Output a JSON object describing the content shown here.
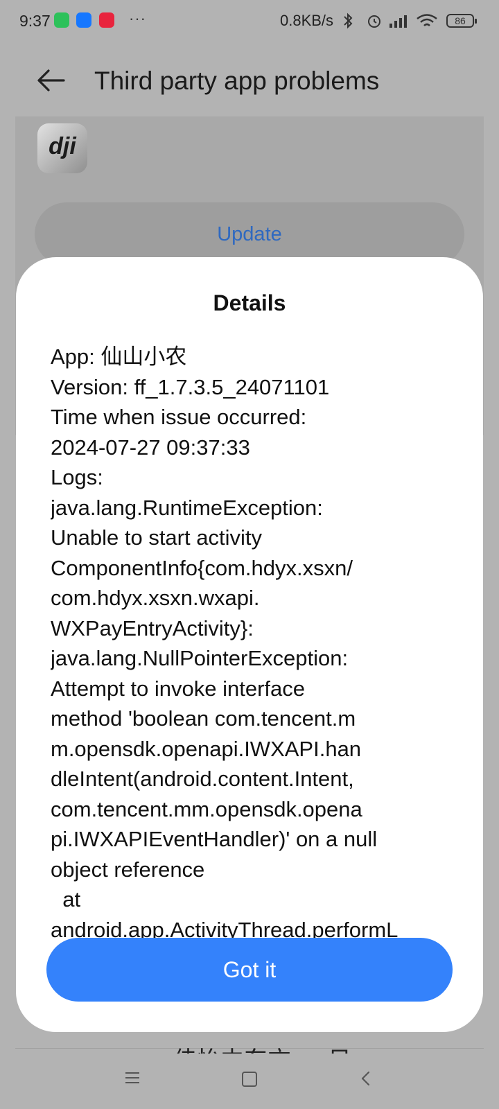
{
  "status_bar": {
    "time": "9:37",
    "dots": "···",
    "network_speed": "0.8KB/s",
    "battery": "86"
  },
  "header": {
    "title": "Third party app problems"
  },
  "background_card": {
    "app_logo_text": "dji",
    "update_label": "Update",
    "bottom_partial_text": "佳怡中东方 一 日 "
  },
  "dialog": {
    "title": "Details",
    "details": "App: 仙山小农\nVersion: ff_1.7.3.5_24071101\nTime when issue occurred:\n2024-07-27 09:37:33\nLogs:\njava.lang.RuntimeException:\nUnable to start activity\nComponentInfo{com.hdyx.xsxn/\ncom.hdyx.xsxn.wxapi.\nWXPayEntryActivity}:\njava.lang.NullPointerException:\nAttempt to invoke interface\nmethod 'boolean com.tencent.m\nm.opensdk.openapi.IWXAPI.han\ndleIntent(android.content.Intent,\ncom.tencent.mm.opensdk.opena\npi.IWXAPIEventHandler)' on a null\nobject reference\n  at\nandroid.app.ActivityThread.performL",
    "confirm_label": "Got it"
  },
  "colors": {
    "accent": "#3482fb",
    "link": "#2f69c0",
    "scrim": "#b3b3b3"
  }
}
